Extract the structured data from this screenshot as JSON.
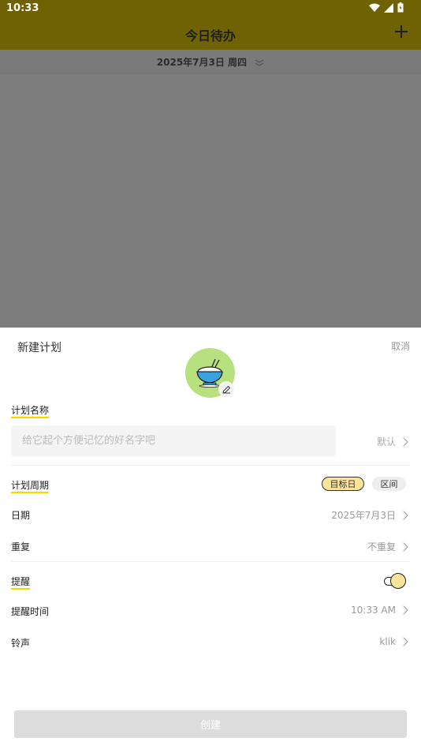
{
  "status_bar": {
    "time": "10:33"
  },
  "app_bar": {
    "title": "今日待办",
    "add_icon": "plus-icon"
  },
  "date_bar": {
    "date": "2025年7月3日 周四"
  },
  "sheet": {
    "title": "新建计划",
    "cancel_label": "取消",
    "icon": "rice-bowl-icon",
    "name_section": {
      "label": "计划名称",
      "placeholder": "给它起个方便记忆的好名字吧",
      "default_label": "默认"
    },
    "period": {
      "label": "计划周期",
      "chips": [
        "目标日",
        "区间"
      ],
      "selected": "目标日"
    },
    "date_row": {
      "label": "日期",
      "value": "2025年7月3日"
    },
    "repeat_row": {
      "label": "重复",
      "value": "不重复"
    },
    "reminder": {
      "label": "提醒",
      "enabled": true
    },
    "reminder_time_row": {
      "label": "提醒时间",
      "value": "10:33 AM"
    },
    "ringtone_row": {
      "label": "铃声",
      "value": "klik"
    },
    "create_label": "创建"
  },
  "colors": {
    "app_bar": "#6f6202",
    "accent_yellow": "#f5d800",
    "chip_selected": "#fbe39a",
    "avatar_bg": "#b7e07e"
  }
}
